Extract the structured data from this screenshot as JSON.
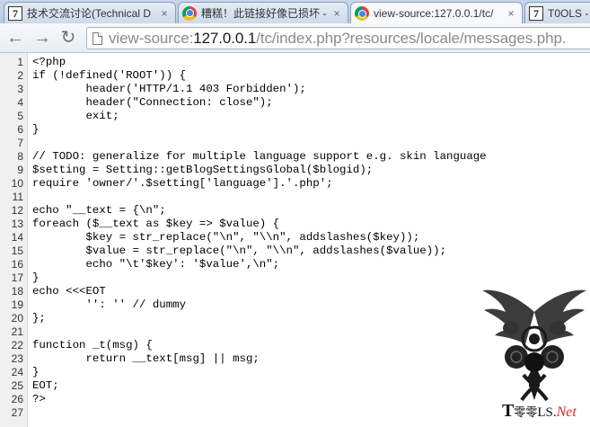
{
  "tabs": [
    {
      "title": "技术交流讨论(Technical D",
      "icon": "seven-icon",
      "active": false
    },
    {
      "title": "糟糕！此链接好像已损坏 -",
      "icon": "chrome-icon",
      "active": false
    },
    {
      "title": "view-source:127.0.0.1/tc/",
      "icon": "chrome-icon",
      "active": true
    },
    {
      "title": "T0OLS -",
      "icon": "seven-icon",
      "active": false
    }
  ],
  "tab_close_glyph": "×",
  "toolbar": {
    "back_glyph": "←",
    "forward_glyph": "→",
    "reload_glyph": "↻"
  },
  "address": {
    "scheme": "view-source:",
    "host": "127.0.0.1",
    "path": "/tc/index.php?resources/locale/messages.php."
  },
  "source_lines": [
    {
      "n": "1",
      "code": "<?php"
    },
    {
      "n": "2",
      "code": "if (!defined('ROOT')) {"
    },
    {
      "n": "3",
      "code": "        header('HTTP/1.1 403 Forbidden');"
    },
    {
      "n": "4",
      "code": "        header(\"Connection: close\");"
    },
    {
      "n": "5",
      "code": "        exit;"
    },
    {
      "n": "6",
      "code": "}"
    },
    {
      "n": "7",
      "code": ""
    },
    {
      "n": "8",
      "code": "// TODO: generalize for multiple language support e.g. skin language"
    },
    {
      "n": "9",
      "code": "$setting = Setting::getBlogSettingsGlobal($blogid);"
    },
    {
      "n": "10",
      "code": "require 'owner/'.$setting['language'].'.php';"
    },
    {
      "n": "11",
      "code": ""
    },
    {
      "n": "12",
      "code": "echo \"__text = {\\n\";"
    },
    {
      "n": "13",
      "code": "foreach ($__text as $key => $value) {"
    },
    {
      "n": "14",
      "code": "        $key = str_replace(\"\\n\", \"\\\\n\", addslashes($key));"
    },
    {
      "n": "15",
      "code": "        $value = str_replace(\"\\n\", \"\\\\n\", addslashes($value));"
    },
    {
      "n": "16",
      "code": "        echo \"\\t'$key': '$value',\\n\";"
    },
    {
      "n": "17",
      "code": "}"
    },
    {
      "n": "18",
      "code": "echo <<<EOT"
    },
    {
      "n": "19",
      "code": "        '': '' // dummy"
    },
    {
      "n": "20",
      "code": "};"
    },
    {
      "n": "21",
      "code": ""
    },
    {
      "n": "22",
      "code": "function _t(msg) {"
    },
    {
      "n": "23",
      "code": "        return __text[msg] || msg;"
    },
    {
      "n": "24",
      "code": "}"
    },
    {
      "n": "25",
      "code": "EOT;"
    },
    {
      "n": "26",
      "code": "?>"
    },
    {
      "n": "27",
      "code": ""
    }
  ],
  "watermark": {
    "prefix": "T",
    "middle": "零零",
    "suffix": "LS.",
    "net": "Net",
    "colors": {
      "ink": "#111111",
      "net": "#d8261c"
    }
  }
}
